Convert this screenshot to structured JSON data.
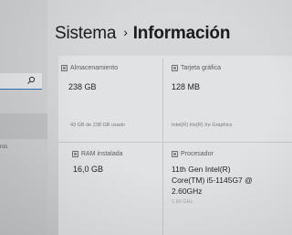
{
  "breadcrumb": {
    "parent": "Sistema",
    "separator": "›",
    "current": "Información"
  },
  "sidebar": {
    "partial_text": "ros"
  },
  "cards": {
    "storage": {
      "label": "Almacenamiento",
      "value": "238 GB",
      "detail": "43 GB de 238 GB usado"
    },
    "graphics": {
      "label": "Tarjeta gráfica",
      "value": "128 MB",
      "detail": "Intel(R) Iris(R) Xe Graphics"
    },
    "ram": {
      "label": "RAM instalada",
      "value": "16,0 GB"
    },
    "processor": {
      "label": "Procesador",
      "value_lines": [
        "11th Gen Intel(R)",
        "Core(TM) i5-1145G7 @",
        "2.60GHz"
      ],
      "detail_partial": "1.50 GHz"
    }
  },
  "icons": [
    "search-icon",
    "storage-icon",
    "graphics-card-icon",
    "ram-icon",
    "processor-icon"
  ],
  "colors": {
    "accent": "#2f6fb5"
  }
}
